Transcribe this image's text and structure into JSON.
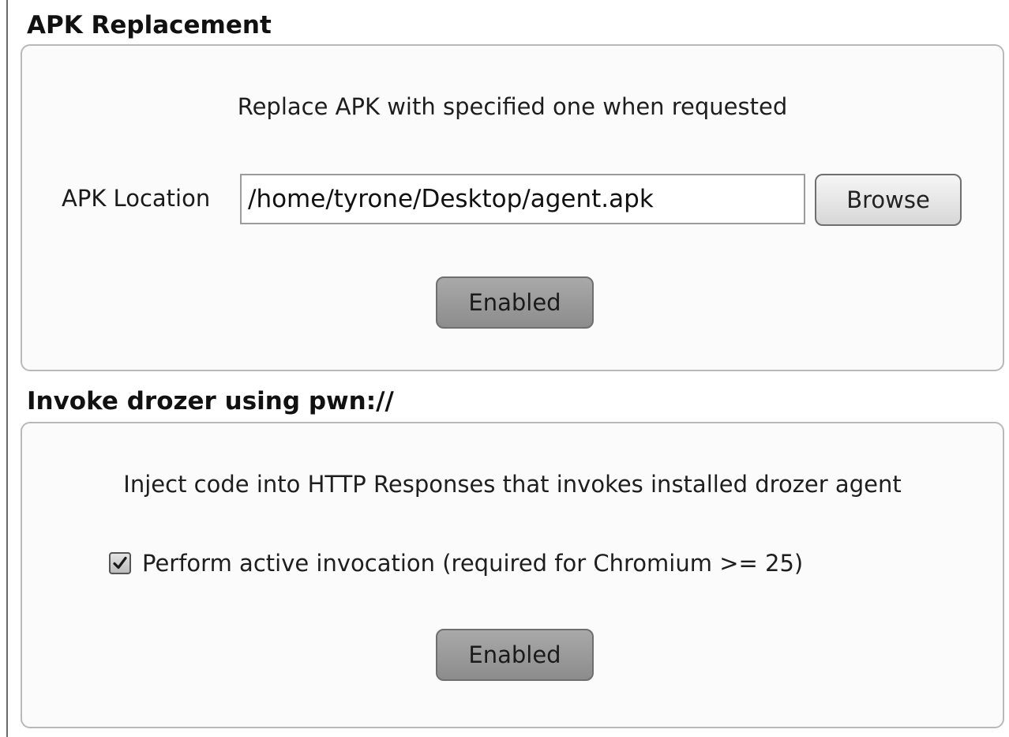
{
  "apk_replacement": {
    "title": "APK Replacement",
    "description": "Replace APK with specified one when requested",
    "location_label": "APK Location",
    "location_value": "/home/tyrone/Desktop/agent.apk",
    "browse_label": "Browse",
    "enabled_label": "Enabled"
  },
  "invoke_drozer": {
    "title": "Invoke drozer using pwn://",
    "description": "Inject code into HTTP Responses that invokes installed drozer agent",
    "checkbox_label": "Perform active invocation (required for Chromium >= 25)",
    "checkbox_checked": true,
    "enabled_label": "Enabled"
  },
  "icons": {
    "checkbox": "checkmark-icon"
  },
  "colors": {
    "panel_border": "#b9b9b9",
    "enabled_button": "#9a9a9a",
    "browse_button": "#e6e6e6"
  }
}
